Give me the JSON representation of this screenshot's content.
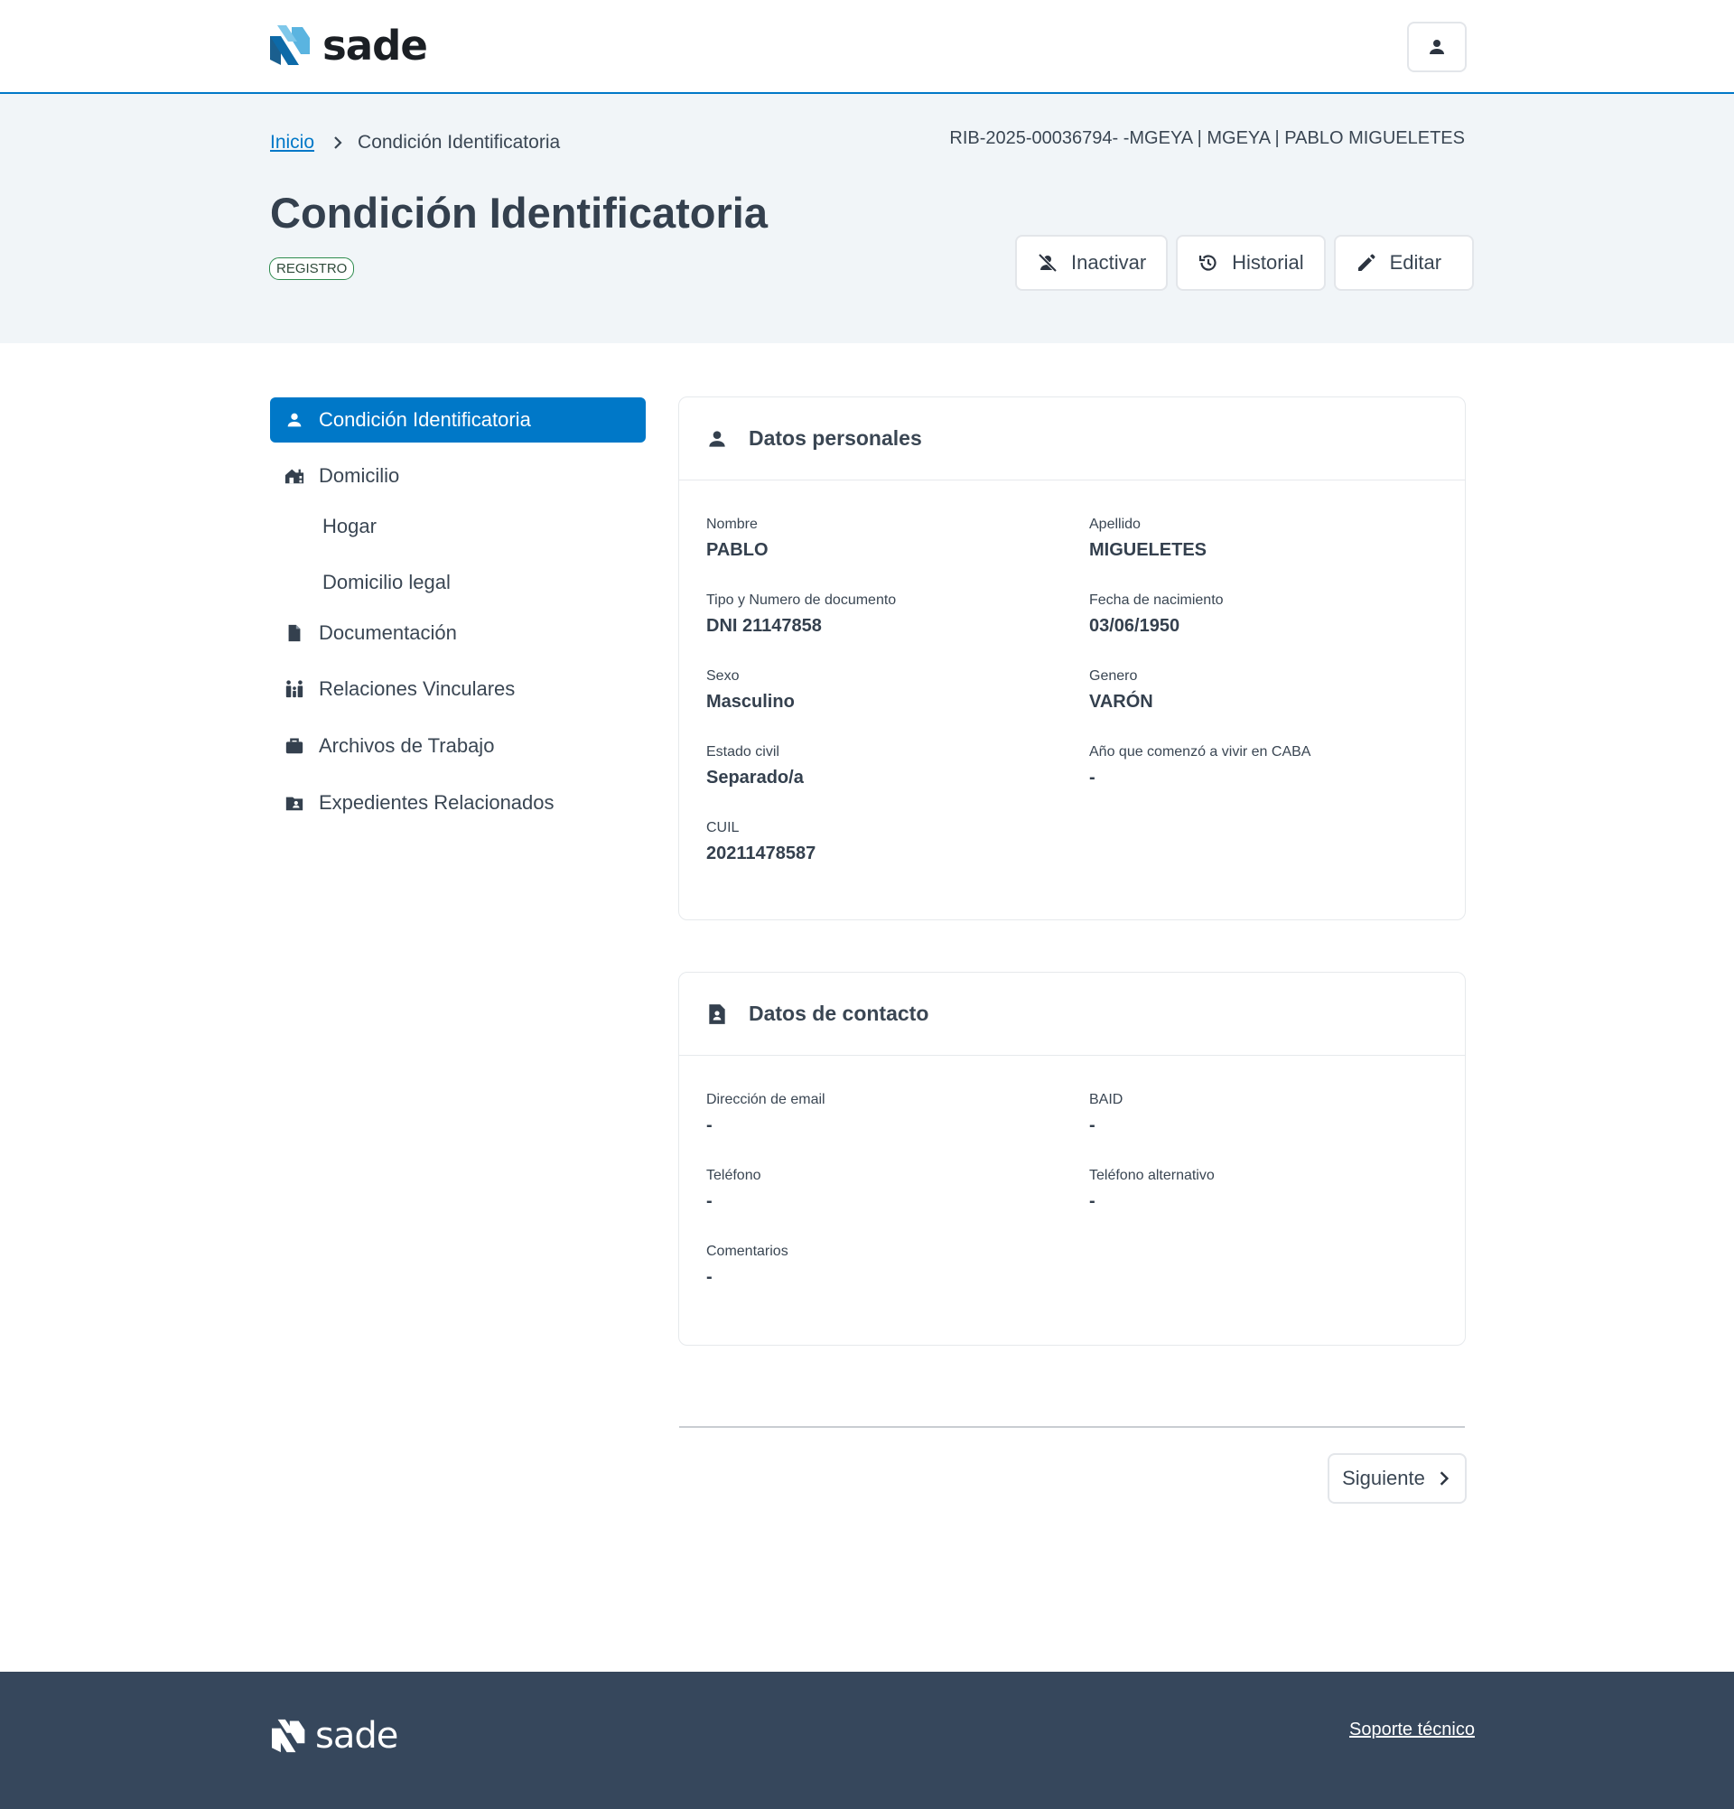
{
  "brand": {
    "name": "sade"
  },
  "header": {
    "user_icon": "person-icon"
  },
  "breadcrumb": {
    "home": "Inicio",
    "current": "Condición Identificatoria"
  },
  "record_info": "RIB-2025-00036794- -MGEYA | MGEYA | PABLO MIGUELETES",
  "page": {
    "title": "Condición Identificatoria",
    "badge": "REGISTRO"
  },
  "actions": {
    "inactivar": "Inactivar",
    "historial": "Historial",
    "editar": "Editar"
  },
  "sidebar": {
    "items": [
      {
        "label": "Condición Identificatoria",
        "icon": "person-icon",
        "active": true
      },
      {
        "label": "Domicilio",
        "icon": "house-icon"
      },
      {
        "label": "Hogar"
      },
      {
        "label": "Domicilio legal"
      },
      {
        "label": "Documentación",
        "icon": "document-icon"
      },
      {
        "label": "Relaciones Vinculares",
        "icon": "family-icon"
      },
      {
        "label": "Archivos de Trabajo",
        "icon": "briefcase-icon"
      },
      {
        "label": "Expedientes Relacionados",
        "icon": "folder-person-icon"
      }
    ]
  },
  "personal": {
    "title": "Datos personales",
    "fields": [
      {
        "label": "Nombre",
        "value": "PABLO"
      },
      {
        "label": "Apellido",
        "value": "MIGUELETES"
      },
      {
        "label": "Tipo y Numero de documento",
        "value": "DNI 21147858"
      },
      {
        "label": "Fecha de nacimiento",
        "value": "03/06/1950"
      },
      {
        "label": "Sexo",
        "value": "Masculino"
      },
      {
        "label": "Genero",
        "value": "VARÓN"
      },
      {
        "label": "Estado civil",
        "value": "Separado/a"
      },
      {
        "label": "Año que comenzó a vivir en CABA",
        "value": "-"
      },
      {
        "label": "CUIL",
        "value": "20211478587"
      }
    ]
  },
  "contact": {
    "title": "Datos de contacto",
    "fields": [
      {
        "label": "Dirección de email",
        "value": "-"
      },
      {
        "label": "BAID",
        "value": "-"
      },
      {
        "label": "Teléfono",
        "value": "-"
      },
      {
        "label": "Teléfono alternativo",
        "value": "-"
      },
      {
        "label": "Comentarios",
        "value": "-"
      }
    ]
  },
  "pager": {
    "next": "Siguiente"
  },
  "footer": {
    "brand": "sade",
    "support": "Soporte técnico"
  },
  "colors": {
    "primary": "#0078c8",
    "footer": "#36475c",
    "hero": "#f1f5f8"
  }
}
